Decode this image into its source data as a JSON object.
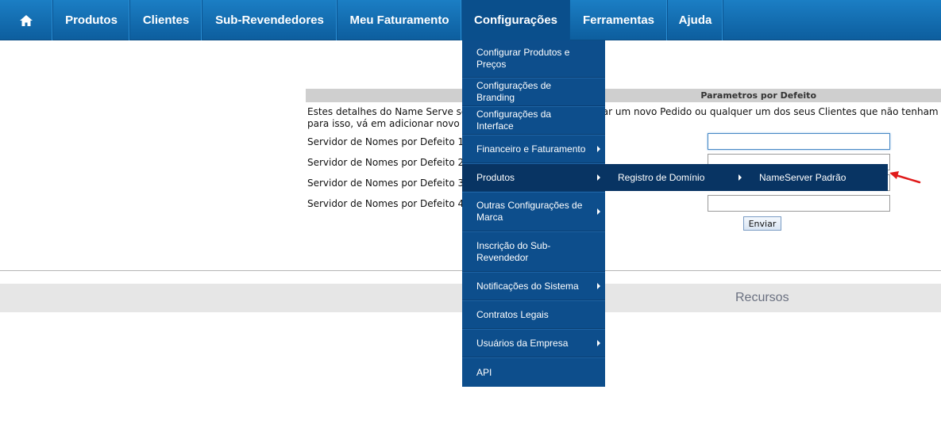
{
  "nav": {
    "home_icon": "home-icon",
    "items": [
      "Produtos",
      "Clientes",
      "Sub-Revendedores",
      "Meu Faturamento",
      "Configurações",
      "Ferramentas",
      "Ajuda"
    ],
    "active": "Configurações"
  },
  "form": {
    "header": "Parametros por Defeito",
    "desc_line1": "Estes detalhes do Name Serve ser                                  dicionar um novo Pedido ou qualquer um dos seus Clientes que não tenham",
    "desc_line2": "para isso, vá em adicionar novo p",
    "labels": [
      "Servidor de Nomes por Defeito 1",
      "Servidor de Nomes por Defeito 2",
      "Servidor de Nomes por Defeito 3",
      "Servidor de Nomes por Defeito 4"
    ],
    "values": [
      "",
      "",
      "",
      ""
    ],
    "submit": "Enviar"
  },
  "resources": "Recursos",
  "dropdown": {
    "items": [
      {
        "label": "Configurar Produtos e Preços",
        "submenu": false
      },
      {
        "label": "Configurações de Branding",
        "submenu": false
      },
      {
        "label": "Configurações da Interface",
        "submenu": false
      },
      {
        "label": "Financeiro e Faturamento",
        "submenu": true
      },
      {
        "label": "Produtos",
        "submenu": true
      },
      {
        "label": "Outras Configurações de Marca",
        "submenu": true
      },
      {
        "label": "Inscrição do Sub-Revendedor",
        "submenu": false
      },
      {
        "label": "Notificações do Sistema",
        "submenu": true
      },
      {
        "label": "Contratos Legais",
        "submenu": false
      },
      {
        "label": "Usuários da Empresa",
        "submenu": true
      },
      {
        "label": "API",
        "submenu": false
      }
    ],
    "highlighted": "Produtos",
    "submenu_level1": "Registro de Domínio",
    "submenu_level2": "NameServer Padrão"
  },
  "colors": {
    "nav_blue": "#1b7ec4",
    "menu_blue": "#0d4e8c",
    "menu_highlight": "#083463",
    "annotation_red": "#e01b1b"
  }
}
